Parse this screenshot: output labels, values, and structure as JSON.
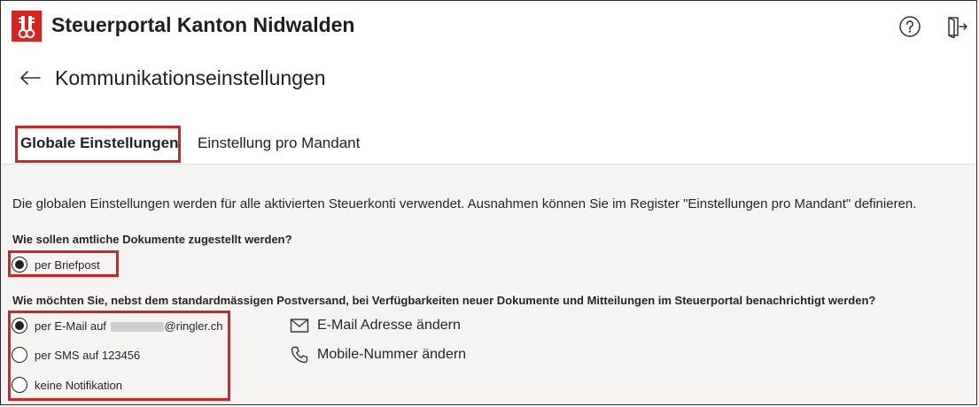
{
  "header": {
    "app_title": "Steuerportal Kanton Nidwalden",
    "logo_icon": "nidwalden-coat-of-arms",
    "help_icon": "question-circle-icon",
    "logout_icon": "sign-out-icon",
    "brand_color": "#d9231d"
  },
  "page": {
    "title": "Kommunikationseinstellungen",
    "back_icon": "arrow-left-icon"
  },
  "tabs": [
    {
      "label": "Globale Einstellungen",
      "active": true
    },
    {
      "label": "Einstellung pro Mandant",
      "active": false
    }
  ],
  "content": {
    "intro": "Die globalen Einstellungen werden für alle aktivierten Steuerkonti verwendet. Ausnahmen können Sie im Register \"Einstellungen pro Mandant\" definieren.",
    "question1": "Wie sollen amtliche Dokumente zugestellt werden?",
    "delivery_options": [
      {
        "label": "per Briefpost",
        "selected": true
      }
    ],
    "question2": "Wie möchten Sie, nebst dem standardmässigen Postversand, bei Verfügbarkeiten neuer Dokumente und Mitteilungen im Steuerportal benachrichtigt werden?",
    "notification_options": [
      {
        "label_prefix": "per E-Mail auf",
        "label_suffix": "@ringler.ch",
        "selected": true
      },
      {
        "label": "per SMS auf 123456",
        "selected": false
      },
      {
        "label": "keine Notifikation",
        "selected": false
      }
    ],
    "actions": [
      {
        "label": "E-Mail Adresse ändern",
        "icon": "envelope-icon"
      },
      {
        "label": "Mobile-Nummer ändern",
        "icon": "phone-icon"
      }
    ]
  },
  "colors": {
    "highlight": "#d42323",
    "content_background": "#f5f4f3"
  }
}
